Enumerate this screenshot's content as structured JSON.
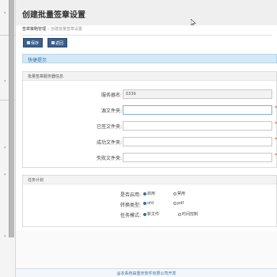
{
  "page": {
    "title": "创建批量签章设置"
  },
  "breadcrumb": {
    "parent": "签章策略管理",
    "separator": "›",
    "current": "创建批量签章设置"
  },
  "toolbar": {
    "save_label": "保存",
    "back_label": "返回"
  },
  "tip": {
    "text": "快捷提示"
  },
  "server_section": {
    "title": "批量签章服务器信息",
    "fields": [
      {
        "label": "服务器名:",
        "value": "0339",
        "placeholder": ""
      },
      {
        "label": "源文件夹:",
        "value": "",
        "placeholder": ""
      },
      {
        "label": "已签文件夹:",
        "value": "",
        "placeholder": ""
      },
      {
        "label": "成功文件夹:",
        "value": "",
        "placeholder": ""
      },
      {
        "label": "失败文件夹:",
        "value": "",
        "placeholder": ""
      }
    ],
    "required_mark": "*"
  },
  "task_section": {
    "title": "任务计划",
    "rows": [
      {
        "label": "是否启用:",
        "options": [
          "启用",
          "禁用"
        ],
        "selected": 0
      },
      {
        "label": "转换类型:",
        "options": [
          "ofd",
          "pdf"
        ],
        "selected": 0
      },
      {
        "label": "任务模式:",
        "options": [
          "新文件",
          "时间控制"
        ],
        "selected": 0
      }
    ]
  },
  "footer": {
    "text": "@本系统由重庆软件有限公司开发"
  }
}
